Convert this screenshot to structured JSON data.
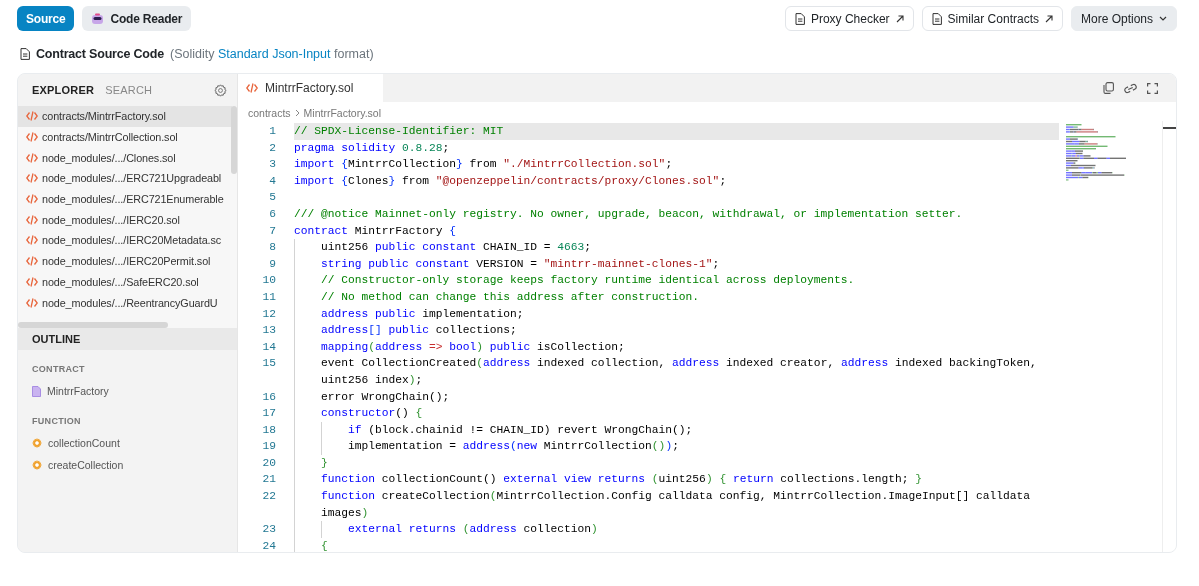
{
  "toolbar": {
    "tabs": [
      {
        "label": "Source",
        "selected": true,
        "kind": "plain"
      },
      {
        "label": "Code Reader",
        "selected": false,
        "kind": "reader"
      }
    ],
    "actions": [
      {
        "label": "Proxy Checker",
        "kind": "proxy"
      },
      {
        "label": "Similar Contracts",
        "kind": "similar"
      },
      {
        "label": "More Options",
        "kind": "menu"
      }
    ]
  },
  "heading": {
    "title": "Contract Source Code",
    "note_prefix": "(Solidity",
    "link": "Standard Json-Input",
    "note_suffix": "format)"
  },
  "sidebar": {
    "tabs": [
      {
        "label": "EXPLORER",
        "selected": true
      },
      {
        "label": "SEARCH",
        "selected": false
      }
    ],
    "files": [
      {
        "name": "contracts/MintrrFactory.sol",
        "selected": true
      },
      {
        "name": "contracts/MintrrCollection.sol",
        "selected": false
      },
      {
        "name": "node_modules/.../Clones.sol",
        "selected": false
      },
      {
        "name": "node_modules/.../ERC721Upgradeabl",
        "selected": false
      },
      {
        "name": "node_modules/.../ERC721Enumerable",
        "selected": false
      },
      {
        "name": "node_modules/.../IERC20.sol",
        "selected": false
      },
      {
        "name": "node_modules/.../IERC20Metadata.sc",
        "selected": false
      },
      {
        "name": "node_modules/.../IERC20Permit.sol",
        "selected": false
      },
      {
        "name": "node_modules/.../SafeERC20.sol",
        "selected": false
      },
      {
        "name": "node_modules/.../ReentrancyGuardU",
        "selected": false
      }
    ],
    "outline": {
      "title": "OUTLINE",
      "groups": [
        {
          "label": "CONTRACT",
          "kind": "contract",
          "items": [
            "MintrrFactory"
          ]
        },
        {
          "label": "FUNCTION",
          "kind": "function",
          "items": [
            "collectionCount",
            "createCollection"
          ]
        }
      ]
    }
  },
  "editor": {
    "tabs": [
      {
        "label": "MintrrFactory.sol",
        "selected": true
      }
    ],
    "breadcrumb": [
      "contracts",
      "MintrrFactory.sol"
    ],
    "lines": [
      {
        "number": "1",
        "current": true,
        "tokens": [
          {
            "text": "// SPDX-License-Identifier: MIT",
            "kind": "comment"
          }
        ]
      },
      {
        "number": "2",
        "current": false,
        "tokens": [
          {
            "text": "pragma",
            "kind": "keyword"
          },
          {
            "text": " solidity",
            "kind": "keyword"
          },
          {
            "text": " 0.8.28",
            "kind": "number"
          },
          {
            "text": ";",
            "kind": "plain"
          }
        ]
      },
      {
        "number": "3",
        "current": false,
        "tokens": [
          {
            "text": "import",
            "kind": "keyword"
          },
          {
            "text": " {",
            "kind": "bracket1"
          },
          {
            "text": "MintrrCollection",
            "kind": "plain"
          },
          {
            "text": "}",
            "kind": "bracket1"
          },
          {
            "text": " from ",
            "kind": "plain"
          },
          {
            "text": "\"./MintrrCollection.sol\"",
            "kind": "string"
          },
          {
            "text": ";",
            "kind": "plain"
          }
        ]
      },
      {
        "number": "4",
        "current": false,
        "tokens": [
          {
            "text": "import",
            "kind": "keyword"
          },
          {
            "text": " {",
            "kind": "bracket1"
          },
          {
            "text": "Clones",
            "kind": "plain"
          },
          {
            "text": "}",
            "kind": "bracket1"
          },
          {
            "text": " from ",
            "kind": "plain"
          },
          {
            "text": "\"@openzeppelin/contracts/proxy/Clones.sol\"",
            "kind": "string"
          },
          {
            "text": ";",
            "kind": "plain"
          }
        ]
      },
      {
        "number": "5",
        "current": false
      },
      {
        "number": "6",
        "current": false,
        "tokens": [
          {
            "text": "/// @notice Mainnet-only registry. No owner, upgrade, beacon, withdrawal, or implementation setter.",
            "kind": "comment"
          }
        ]
      },
      {
        "number": "7",
        "current": false,
        "tokens": [
          {
            "text": "contract",
            "kind": "keyword"
          },
          {
            "text": " MintrrFactory ",
            "kind": "plain"
          },
          {
            "text": "{",
            "kind": "bracket1"
          }
        ]
      },
      {
        "number": "8",
        "current": false,
        "tokens": [
          {
            "text": "    uint256 ",
            "kind": "plain"
          },
          {
            "text": "public",
            "kind": "keyword"
          },
          {
            "text": " constant",
            "kind": "keyword"
          },
          {
            "text": " CHAIN_ID = ",
            "kind": "plain"
          },
          {
            "text": "4663",
            "kind": "number"
          },
          {
            "text": ";",
            "kind": "plain"
          }
        ]
      },
      {
        "number": "9",
        "current": false,
        "tokens": [
          {
            "text": "    string",
            "kind": "keyword"
          },
          {
            "text": " public",
            "kind": "keyword"
          },
          {
            "text": " constant",
            "kind": "keyword"
          },
          {
            "text": " VERSION = ",
            "kind": "plain"
          },
          {
            "text": "\"mintrr-mainnet-clones-1\"",
            "kind": "string"
          },
          {
            "text": ";",
            "kind": "plain"
          }
        ]
      },
      {
        "number": "10",
        "current": false,
        "tokens": [
          {
            "text": "    // Constructor-only storage keeps factory runtime identical across deployments.",
            "kind": "comment"
          }
        ]
      },
      {
        "number": "11",
        "current": false,
        "tokens": [
          {
            "text": "    // No method can change this address after construction.",
            "kind": "comment"
          }
        ]
      },
      {
        "number": "12",
        "current": false,
        "tokens": [
          {
            "text": "    address",
            "kind": "keyword"
          },
          {
            "text": " public",
            "kind": "keyword"
          },
          {
            "text": " implementation;",
            "kind": "plain"
          }
        ]
      },
      {
        "number": "13",
        "current": false,
        "tokens": [
          {
            "text": "    address",
            "kind": "keyword"
          },
          {
            "text": "[]",
            "kind": "bracket1"
          },
          {
            "text": " public",
            "kind": "keyword"
          },
          {
            "text": " collections;",
            "kind": "plain"
          }
        ]
      },
      {
        "number": "14",
        "current": false,
        "tokens": [
          {
            "text": "    mapping",
            "kind": "keyword"
          },
          {
            "text": "(",
            "kind": "bracket2"
          },
          {
            "text": "address",
            "kind": "keyword"
          },
          {
            "text": " =>",
            "kind": "operator"
          },
          {
            "text": " bool",
            "kind": "keyword"
          },
          {
            "text": ")",
            "kind": "bracket2"
          },
          {
            "text": " public",
            "kind": "keyword"
          },
          {
            "text": " isCollection;",
            "kind": "plain"
          }
        ]
      },
      {
        "number": "15",
        "current": false,
        "tokens": [
          {
            "text": "    event CollectionCreated",
            "kind": "plain"
          },
          {
            "text": "(",
            "kind": "bracket2"
          },
          {
            "text": "address",
            "kind": "keyword"
          },
          {
            "text": " indexed collection, ",
            "kind": "plain"
          },
          {
            "text": "address",
            "kind": "keyword"
          },
          {
            "text": " indexed creator, ",
            "kind": "plain"
          },
          {
            "text": "address",
            "kind": "keyword"
          },
          {
            "text": " indexed backingToken, uint256 index",
            "kind": "plain"
          },
          {
            "text": ")",
            "kind": "bracket2"
          },
          {
            "text": ";",
            "kind": "plain"
          }
        ]
      },
      {
        "number": "16",
        "current": false,
        "tokens": [
          {
            "text": "    error WrongChain();",
            "kind": "plain"
          }
        ]
      },
      {
        "number": "17",
        "current": false,
        "tokens": [
          {
            "text": "    constructor",
            "kind": "keyword"
          },
          {
            "text": "() ",
            "kind": "plain"
          },
          {
            "text": "{",
            "kind": "bracket2"
          }
        ]
      },
      {
        "number": "18",
        "current": false,
        "tokens": [
          {
            "text": "        if",
            "kind": "keyword"
          },
          {
            "text": " (block.chainid != CHAIN_ID) revert WrongChain();",
            "kind": "plain"
          }
        ]
      },
      {
        "number": "19",
        "current": false,
        "tokens": [
          {
            "text": "        implementation = ",
            "kind": "plain"
          },
          {
            "text": "address",
            "kind": "keyword"
          },
          {
            "text": "(",
            "kind": "bracket1"
          },
          {
            "text": "new",
            "kind": "keyword"
          },
          {
            "text": " MintrrCollection",
            "kind": "plain"
          },
          {
            "text": "()",
            "kind": "bracket2"
          },
          {
            "text": ")",
            "kind": "bracket1"
          },
          {
            "text": ";",
            "kind": "plain"
          }
        ]
      },
      {
        "number": "20",
        "current": false,
        "tokens": [
          {
            "text": "    }",
            "kind": "bracket2"
          }
        ]
      },
      {
        "number": "21",
        "current": false,
        "tokens": [
          {
            "text": "    function",
            "kind": "keyword"
          },
          {
            "text": " collectionCount() ",
            "kind": "plain"
          },
          {
            "text": "external",
            "kind": "keyword"
          },
          {
            "text": " view",
            "kind": "keyword"
          },
          {
            "text": " returns",
            "kind": "keyword"
          },
          {
            "text": " (",
            "kind": "bracket2"
          },
          {
            "text": "uint256",
            "kind": "plain"
          },
          {
            "text": ")",
            "kind": "bracket2"
          },
          {
            "text": " {",
            "kind": "bracket2"
          },
          {
            "text": " return",
            "kind": "keyword"
          },
          {
            "text": " collections.length; ",
            "kind": "plain"
          },
          {
            "text": "}",
            "kind": "bracket2"
          }
        ]
      },
      {
        "number": "22",
        "current": false,
        "tokens": [
          {
            "text": "    function",
            "kind": "keyword"
          },
          {
            "text": " createCollection",
            "kind": "plain"
          },
          {
            "text": "(",
            "kind": "bracket2"
          },
          {
            "text": "MintrrCollection.Config calldata config, MintrrCollection.ImageInput[] calldata images",
            "kind": "plain"
          },
          {
            "text": ")",
            "kind": "bracket2"
          }
        ]
      },
      {
        "number": "23",
        "current": false,
        "tokens": [
          {
            "text": "        external",
            "kind": "keyword"
          },
          {
            "text": " returns",
            "kind": "keyword"
          },
          {
            "text": " (",
            "kind": "bracket2"
          },
          {
            "text": "address",
            "kind": "keyword"
          },
          {
            "text": " collection",
            "kind": "plain"
          },
          {
            "text": ")",
            "kind": "bracket2"
          }
        ]
      },
      {
        "number": "24",
        "current": false,
        "tokens": [
          {
            "text": "    {",
            "kind": "bracket2"
          }
        ]
      }
    ]
  }
}
